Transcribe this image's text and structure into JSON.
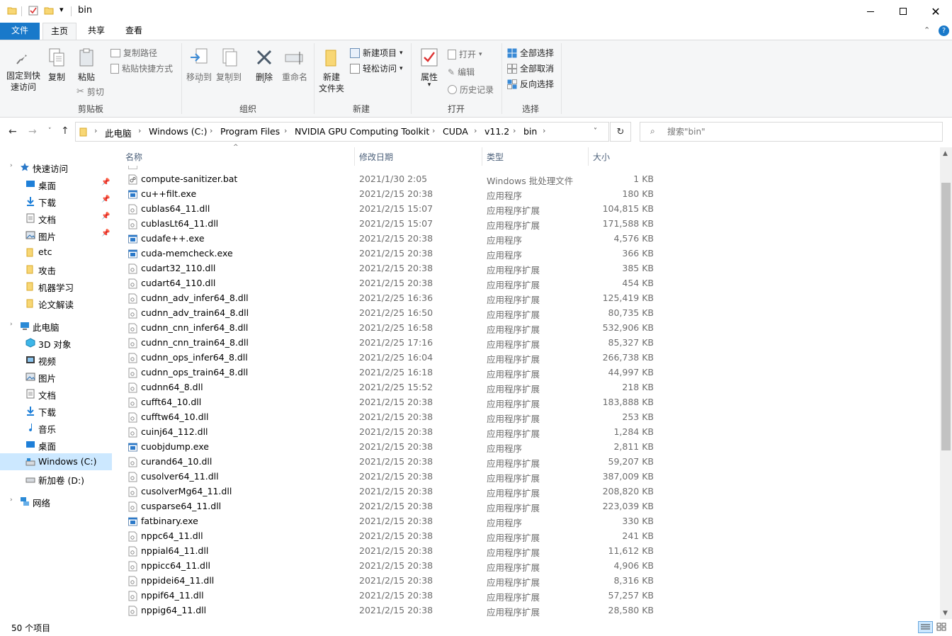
{
  "window": {
    "title": "bin"
  },
  "ribbon_tabs": [
    "文件",
    "主页",
    "共享",
    "查看"
  ],
  "ribbon": {
    "clipboard": {
      "label": "剪贴板",
      "pin_line1": "固定到快",
      "pin_line2": "速访问",
      "copy": "复制",
      "paste": "粘贴",
      "copy_path": "复制路径",
      "paste_shortcut": "粘贴快捷方式",
      "cut": "剪切"
    },
    "organize": {
      "label": "组织",
      "move_to": "移动到",
      "copy_to": "复制到",
      "delete": "删除",
      "rename": "重命名"
    },
    "new": {
      "label": "新建",
      "new_folder_line1": "新建",
      "new_folder_line2": "文件夹",
      "new_item": "新建项目",
      "easy_access": "轻松访问"
    },
    "open": {
      "label": "打开",
      "properties": "属性",
      "open": "打开",
      "edit": "编辑",
      "history": "历史记录"
    },
    "select": {
      "label": "选择",
      "select_all": "全部选择",
      "select_none": "全部取消",
      "invert": "反向选择"
    }
  },
  "address": {
    "crumbs": [
      "此电脑",
      "Windows (C:)",
      "Program Files",
      "NVIDIA GPU Computing Toolkit",
      "CUDA",
      "v11.2",
      "bin"
    ]
  },
  "search": {
    "placeholder": "搜索\"bin\""
  },
  "nav": {
    "quick_access": "快速访问",
    "quick_items": [
      "桌面",
      "下载",
      "文档",
      "图片",
      "etc",
      "攻击",
      "机器学习",
      "论文解读"
    ],
    "this_pc": "此电脑",
    "pc_items": [
      "3D 对象",
      "视频",
      "图片",
      "文档",
      "下载",
      "音乐",
      "桌面",
      "Windows (C:)",
      "新加卷 (D:)"
    ],
    "network": "网络"
  },
  "columns": {
    "name": "名称",
    "date": "修改日期",
    "type": "类型",
    "size": "大小"
  },
  "files": [
    {
      "name": "compute-sanitizer.bat",
      "date": "2021/1/30 2:05",
      "type": "Windows 批处理文件",
      "size": "1 KB",
      "kind": "bat"
    },
    {
      "name": "cu++filt.exe",
      "date": "2021/2/15 20:38",
      "type": "应用程序",
      "size": "180 KB",
      "kind": "exe"
    },
    {
      "name": "cublas64_11.dll",
      "date": "2021/2/15 15:07",
      "type": "应用程序扩展",
      "size": "104,815 KB",
      "kind": "dll"
    },
    {
      "name": "cublasLt64_11.dll",
      "date": "2021/2/15 15:07",
      "type": "应用程序扩展",
      "size": "171,588 KB",
      "kind": "dll"
    },
    {
      "name": "cudafe++.exe",
      "date": "2021/2/15 20:38",
      "type": "应用程序",
      "size": "4,576 KB",
      "kind": "exe"
    },
    {
      "name": "cuda-memcheck.exe",
      "date": "2021/2/15 20:38",
      "type": "应用程序",
      "size": "366 KB",
      "kind": "exe"
    },
    {
      "name": "cudart32_110.dll",
      "date": "2021/2/15 20:38",
      "type": "应用程序扩展",
      "size": "385 KB",
      "kind": "dll"
    },
    {
      "name": "cudart64_110.dll",
      "date": "2021/2/15 20:38",
      "type": "应用程序扩展",
      "size": "454 KB",
      "kind": "dll"
    },
    {
      "name": "cudnn_adv_infer64_8.dll",
      "date": "2021/2/25 16:36",
      "type": "应用程序扩展",
      "size": "125,419 KB",
      "kind": "dll"
    },
    {
      "name": "cudnn_adv_train64_8.dll",
      "date": "2021/2/25 16:50",
      "type": "应用程序扩展",
      "size": "80,735 KB",
      "kind": "dll"
    },
    {
      "name": "cudnn_cnn_infer64_8.dll",
      "date": "2021/2/25 16:58",
      "type": "应用程序扩展",
      "size": "532,906 KB",
      "kind": "dll"
    },
    {
      "name": "cudnn_cnn_train64_8.dll",
      "date": "2021/2/25 17:16",
      "type": "应用程序扩展",
      "size": "85,327 KB",
      "kind": "dll"
    },
    {
      "name": "cudnn_ops_infer64_8.dll",
      "date": "2021/2/25 16:04",
      "type": "应用程序扩展",
      "size": "266,738 KB",
      "kind": "dll"
    },
    {
      "name": "cudnn_ops_train64_8.dll",
      "date": "2021/2/25 16:18",
      "type": "应用程序扩展",
      "size": "44,997 KB",
      "kind": "dll"
    },
    {
      "name": "cudnn64_8.dll",
      "date": "2021/2/25 15:52",
      "type": "应用程序扩展",
      "size": "218 KB",
      "kind": "dll"
    },
    {
      "name": "cufft64_10.dll",
      "date": "2021/2/15 20:38",
      "type": "应用程序扩展",
      "size": "183,888 KB",
      "kind": "dll"
    },
    {
      "name": "cufftw64_10.dll",
      "date": "2021/2/15 20:38",
      "type": "应用程序扩展",
      "size": "253 KB",
      "kind": "dll"
    },
    {
      "name": "cuinj64_112.dll",
      "date": "2021/2/15 20:38",
      "type": "应用程序扩展",
      "size": "1,284 KB",
      "kind": "dll"
    },
    {
      "name": "cuobjdump.exe",
      "date": "2021/2/15 20:38",
      "type": "应用程序",
      "size": "2,811 KB",
      "kind": "exe"
    },
    {
      "name": "curand64_10.dll",
      "date": "2021/2/15 20:38",
      "type": "应用程序扩展",
      "size": "59,207 KB",
      "kind": "dll"
    },
    {
      "name": "cusolver64_11.dll",
      "date": "2021/2/15 20:38",
      "type": "应用程序扩展",
      "size": "387,009 KB",
      "kind": "dll"
    },
    {
      "name": "cusolverMg64_11.dll",
      "date": "2021/2/15 20:38",
      "type": "应用程序扩展",
      "size": "208,820 KB",
      "kind": "dll"
    },
    {
      "name": "cusparse64_11.dll",
      "date": "2021/2/15 20:38",
      "type": "应用程序扩展",
      "size": "223,039 KB",
      "kind": "dll"
    },
    {
      "name": "fatbinary.exe",
      "date": "2021/2/15 20:38",
      "type": "应用程序",
      "size": "330 KB",
      "kind": "exe"
    },
    {
      "name": "nppc64_11.dll",
      "date": "2021/2/15 20:38",
      "type": "应用程序扩展",
      "size": "241 KB",
      "kind": "dll"
    },
    {
      "name": "nppial64_11.dll",
      "date": "2021/2/15 20:38",
      "type": "应用程序扩展",
      "size": "11,612 KB",
      "kind": "dll"
    },
    {
      "name": "nppicc64_11.dll",
      "date": "2021/2/15 20:38",
      "type": "应用程序扩展",
      "size": "4,906 KB",
      "kind": "dll"
    },
    {
      "name": "nppidei64_11.dll",
      "date": "2021/2/15 20:38",
      "type": "应用程序扩展",
      "size": "8,316 KB",
      "kind": "dll"
    },
    {
      "name": "nppif64_11.dll",
      "date": "2021/2/15 20:38",
      "type": "应用程序扩展",
      "size": "57,257 KB",
      "kind": "dll"
    },
    {
      "name": "nppig64_11.dll",
      "date": "2021/2/15 20:38",
      "type": "应用程序扩展",
      "size": "28,580 KB",
      "kind": "dll"
    }
  ],
  "status": {
    "count": "50 个项目"
  },
  "colors": {
    "accent": "#1979ca",
    "selection": "#cce8ff",
    "folder": "#f8d775"
  }
}
